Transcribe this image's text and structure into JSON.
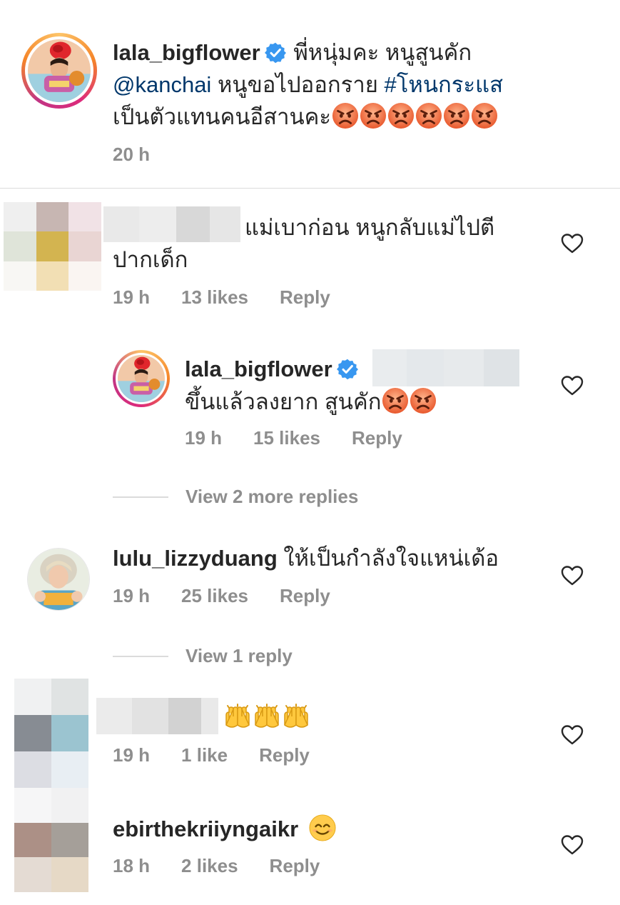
{
  "caption": {
    "username": "lala_bigflower",
    "text_line1": "พี่หนุ่มคะ หนูสูนคัก",
    "mention": "@kanchai",
    "text_line2": "หนูขอไปออกราย",
    "hashtag": "#โหนกระแส",
    "text_line3": "เป็นตัวแทนคนอีสานคะ",
    "emoji": "angry-face",
    "emoji_count": 6,
    "time": "20 h"
  },
  "comments": [
    {
      "username_hidden": true,
      "text_line1": "แม่เบาก่อน หนูกลับแม่ไปตี",
      "text_line2": "ปากเด็ก",
      "time": "19 h",
      "likes": "13 likes",
      "reply_label": "Reply",
      "replies": [
        {
          "username": "lala_bigflower",
          "mention_hidden": true,
          "text": "ขึ้นแล้วลงยาก สูนคัก",
          "emoji": "angry-face",
          "emoji_count": 2,
          "time": "19 h",
          "likes": "15 likes",
          "reply_label": "Reply"
        }
      ],
      "view_more": "View 2 more replies"
    },
    {
      "username": "lulu_lizzyduang",
      "text": "ให้เป็นกำลังใจแหน่เด้อ",
      "time": "19 h",
      "likes": "25 likes",
      "reply_label": "Reply",
      "view_more": "View 1 reply"
    },
    {
      "username_hidden": true,
      "emoji": "raising-hands",
      "emoji_count": 3,
      "time": "19 h",
      "likes": "1 like",
      "reply_label": "Reply"
    },
    {
      "username": "ebirthekriiyngaikr",
      "emoji": "smiling-face",
      "time": "18 h",
      "likes": "2 likes",
      "reply_label": "Reply"
    }
  ],
  "colors": {
    "text": "#262626",
    "secondary": "#8e8e8e",
    "link": "#00376b",
    "verified": "#3897f0",
    "divider": "#dbdbdb"
  }
}
